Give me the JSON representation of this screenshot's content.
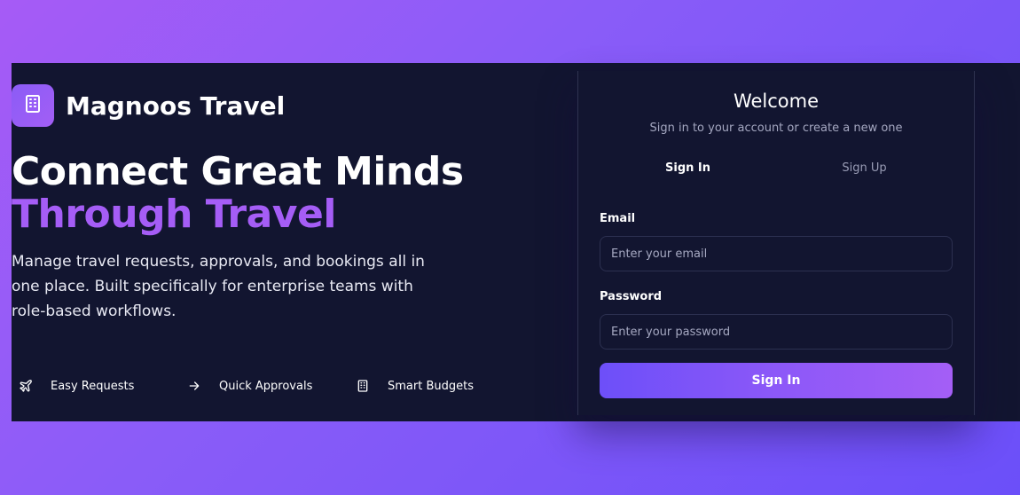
{
  "brand": {
    "name": "Magnoos Travel",
    "icon": "building-icon"
  },
  "hero": {
    "headline_line1": "Connect Great Minds",
    "headline_line2": "Through Travel",
    "description": "Manage travel requests, approvals, and bookings all in one place. Built specifically for enterprise teams with role-based workflows."
  },
  "features": [
    {
      "label": "Easy Requests",
      "icon": "plane-icon"
    },
    {
      "label": "Quick Approvals",
      "icon": "arrow-right-icon"
    },
    {
      "label": "Smart Budgets",
      "icon": "building-icon"
    }
  ],
  "auth": {
    "title": "Welcome",
    "subtitle": "Sign in to your account or create a new one",
    "tabs": [
      {
        "label": "Sign In",
        "active": true
      },
      {
        "label": "Sign Up",
        "active": false
      }
    ],
    "email": {
      "label": "Email",
      "value": "",
      "placeholder": "Enter your email"
    },
    "password": {
      "label": "Password",
      "value": "",
      "placeholder": "Enter your password"
    },
    "submit_label": "Sign In"
  },
  "colors": {
    "accent_purple": "#a55df6",
    "panel_background": "#121530",
    "button_gradient_start": "#6d4ff9",
    "button_gradient_end": "#a45ef6"
  }
}
